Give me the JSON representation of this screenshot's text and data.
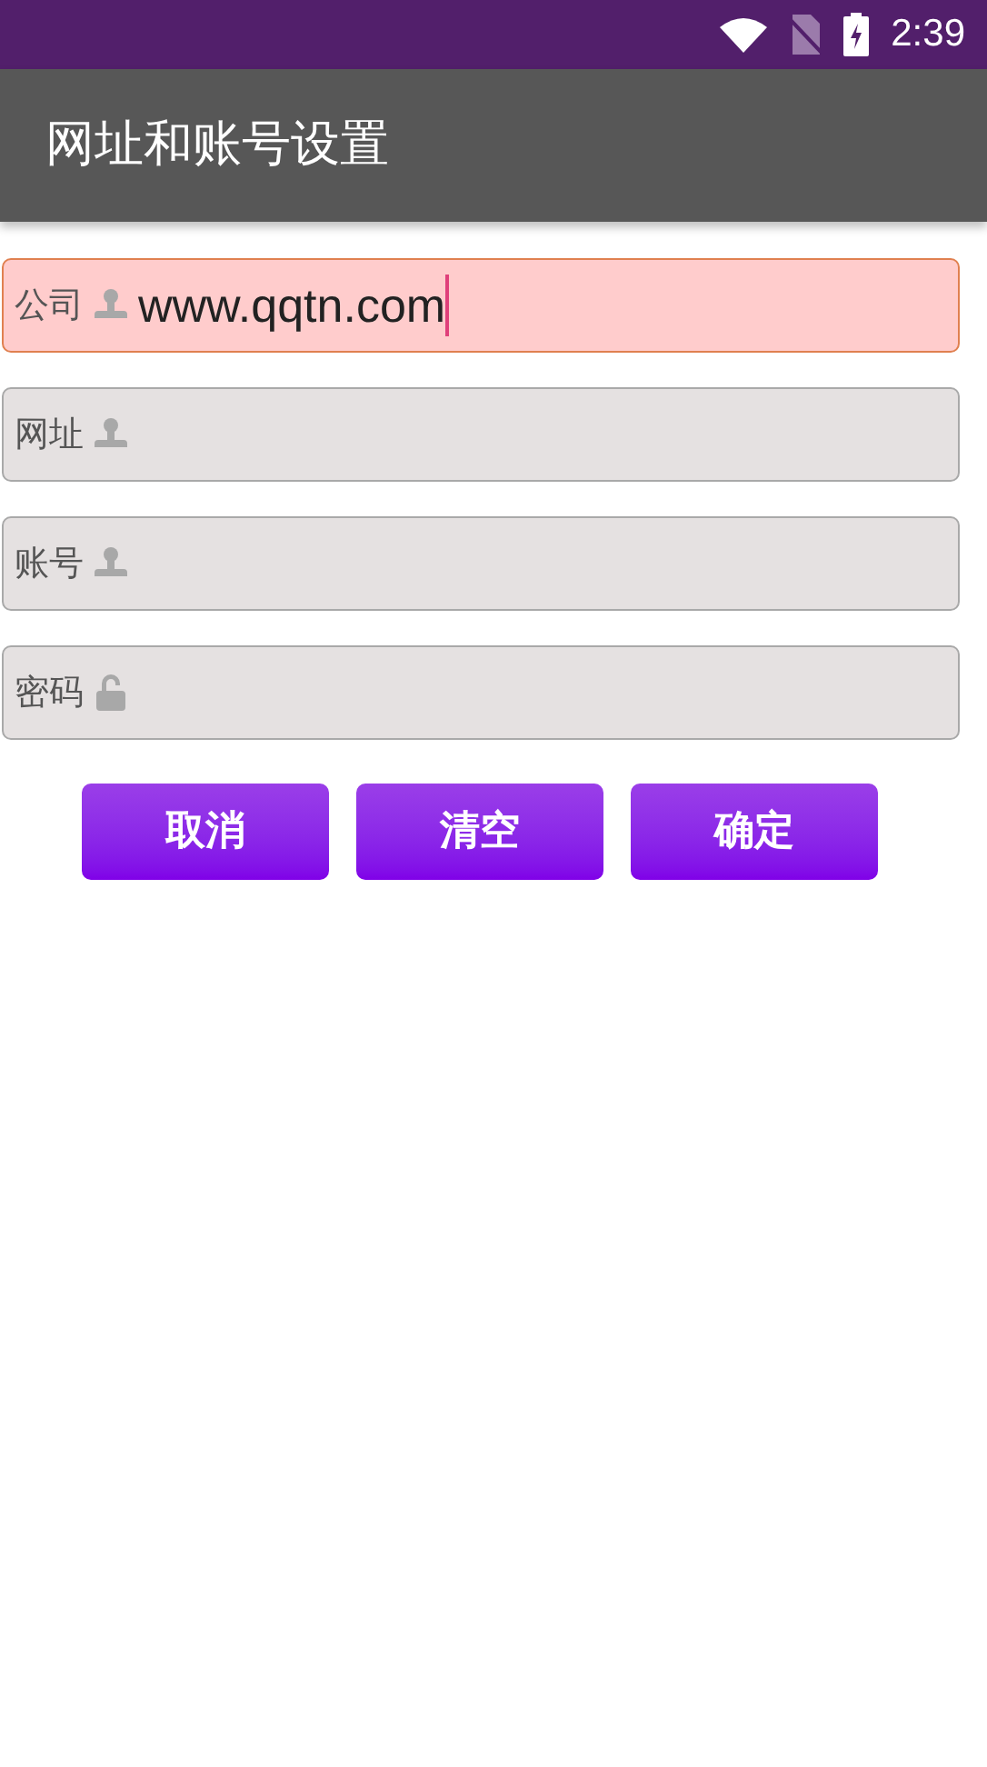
{
  "status_bar": {
    "time": "2:39"
  },
  "app_bar": {
    "title": "网址和账号设置"
  },
  "fields": [
    {
      "label": "公司",
      "kind": "user",
      "value": "www.qqtn.com",
      "focused": true
    },
    {
      "label": "网址",
      "kind": "user",
      "focused": false
    },
    {
      "label": "账号",
      "kind": "user",
      "focused": false
    },
    {
      "label": "密码",
      "kind": "lock",
      "focused": false
    }
  ],
  "buttons": [
    "取消",
    "清空",
    "确定"
  ]
}
